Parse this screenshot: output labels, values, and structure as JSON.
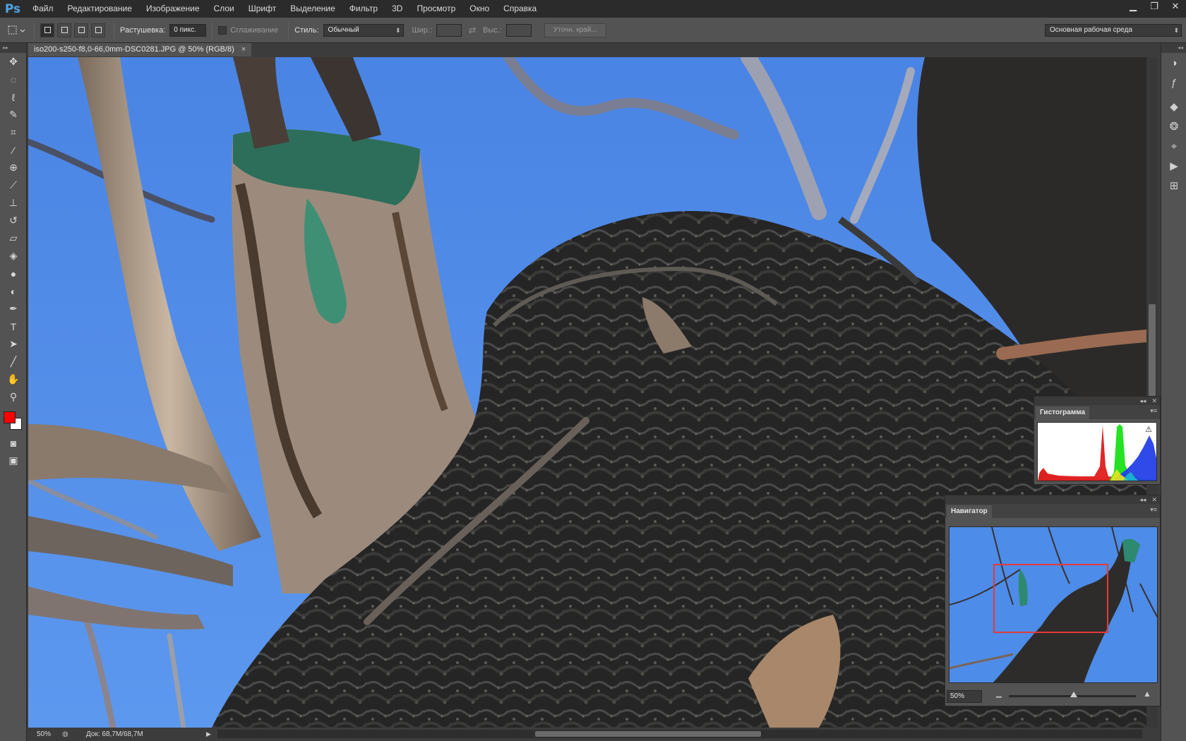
{
  "app": {
    "logo": "Ps"
  },
  "menu": [
    "Файл",
    "Редактирование",
    "Изображение",
    "Слои",
    "Шрифт",
    "Выделение",
    "Фильтр",
    "3D",
    "Просмотр",
    "Окно",
    "Справка"
  ],
  "window_controls": {
    "minimize": "▁",
    "restore": "❐",
    "close": "✕"
  },
  "options": {
    "feather_label": "Растушевка:",
    "feather_value": "0 пикс.",
    "antialias_label": "Сглаживание",
    "style_label": "Стиль:",
    "style_value": "Обычный",
    "width_label": "Шир.:",
    "height_label": "Выс.:",
    "refine_edge": "Уточн. край...",
    "workspace": "Основная рабочая среда"
  },
  "document": {
    "tab_title": "iso200-s250-f8,0-66,0mm-DSC0281.JPG @ 50% (RGB/8)",
    "close": "×"
  },
  "status": {
    "zoom": "50%",
    "doc_info": "Док: 68,7M/68,7M"
  },
  "panels": {
    "histogram": {
      "title": "Гистограмма",
      "warning": "⚠"
    },
    "navigator": {
      "title": "Навигатор",
      "zoom": "50%"
    }
  },
  "tools": [
    "move-tool",
    "marquee-tool",
    "lasso-tool",
    "quick-select-tool",
    "crop-tool",
    "eyedropper-tool",
    "healing-tool",
    "brush-tool",
    "clone-stamp-tool",
    "history-brush-tool",
    "eraser-tool",
    "paint-bucket-tool",
    "blur-tool",
    "dodge-tool",
    "pen-tool",
    "type-tool",
    "path-select-tool",
    "line-tool",
    "hand-tool",
    "zoom-tool"
  ],
  "colors": {
    "foreground": "#ff0000",
    "background": "#ffffff",
    "sky": "#4f8ae6",
    "nav_frame": "#e23a3a"
  }
}
